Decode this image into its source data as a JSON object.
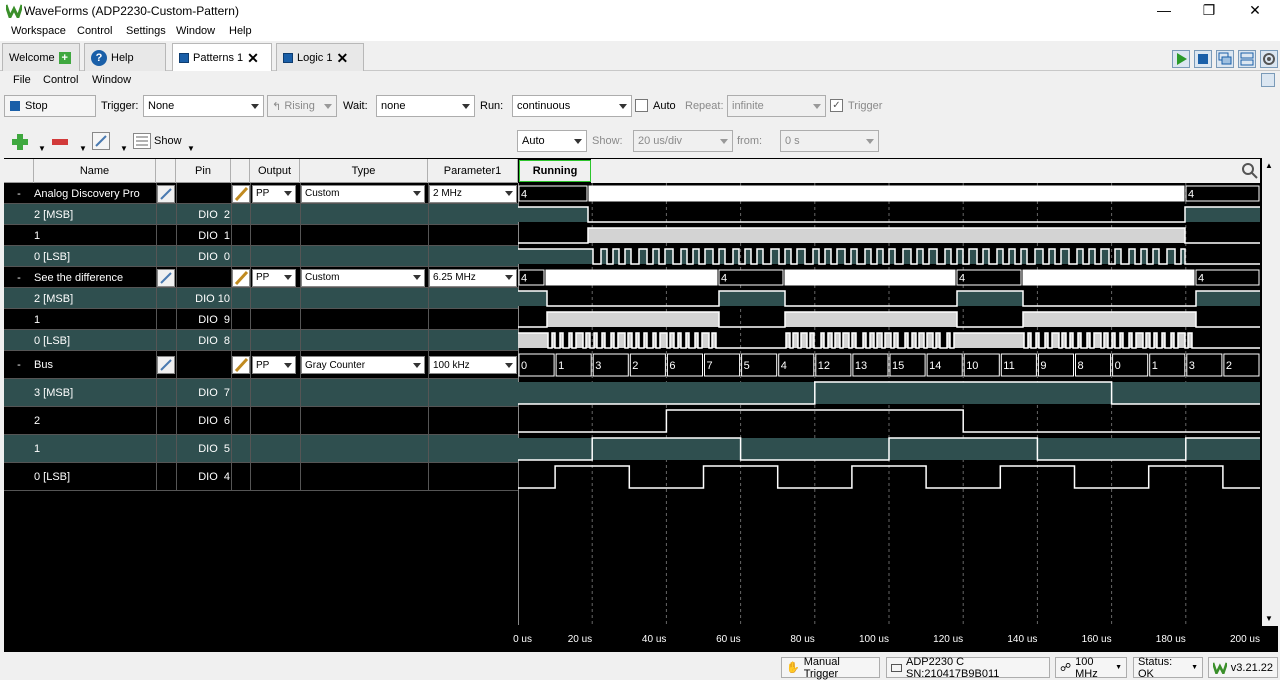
{
  "window": {
    "title": "WaveForms (ADP2230-Custom-Pattern)"
  },
  "menu": [
    "Workspace",
    "Control",
    "Settings",
    "Window",
    "Help"
  ],
  "tabs": [
    {
      "label": "Welcome"
    },
    {
      "label": "Help"
    },
    {
      "label": "Patterns 1",
      "active": true
    },
    {
      "label": "Logic 1"
    }
  ],
  "submenu": [
    "File",
    "Control",
    "Window"
  ],
  "toolbar": {
    "stop_label": "Stop",
    "trigger_label": "Trigger:",
    "trigger_value": "None",
    "edge_value": "Rising",
    "wait_label": "Wait:",
    "wait_value": "none",
    "run_label": "Run:",
    "run_value": "continuous",
    "auto_label": "Auto",
    "repeat_label": "Repeat:",
    "repeat_value": "infinite",
    "trigger_check_label": "Trigger"
  },
  "toolbar2": {
    "show_label": "Show",
    "mode_value": "Auto",
    "show2_label": "Show:",
    "div_value": "20 us/div",
    "from_label": "from:",
    "from_value": "0 s"
  },
  "columns": {
    "name": "Name",
    "pin": "Pin",
    "output": "Output",
    "type": "Type",
    "param": "Parameter1",
    "status": "Running"
  },
  "groups": [
    {
      "name": "Analog Discovery Pro",
      "output": "PP",
      "type": "Custom",
      "param": "2 MHz",
      "channels": [
        {
          "name": "2 [MSB]",
          "pin": "DIO  2"
        },
        {
          "name": "1",
          "pin": "DIO  1"
        },
        {
          "name": "0 [LSB]",
          "pin": "DIO  0"
        }
      ],
      "bus_values": [
        "4",
        "4"
      ]
    },
    {
      "name": "See the difference",
      "output": "PP",
      "type": "Custom",
      "param": "6.25 MHz",
      "channels": [
        {
          "name": "2 [MSB]",
          "pin": "DIO 10"
        },
        {
          "name": "1",
          "pin": "DIO  9"
        },
        {
          "name": "0 [LSB]",
          "pin": "DIO  8"
        }
      ],
      "bus_values": [
        "4",
        "4",
        "4",
        "4"
      ]
    },
    {
      "name": "Bus",
      "output": "PP",
      "type": "Gray Counter",
      "param": "100 kHz",
      "channels": [
        {
          "name": "3 [MSB]",
          "pin": "DIO  7"
        },
        {
          "name": "2",
          "pin": "DIO  6"
        },
        {
          "name": "1",
          "pin": "DIO  5"
        },
        {
          "name": "0 [LSB]",
          "pin": "DIO  4"
        }
      ],
      "bus_values": [
        "0",
        "1",
        "3",
        "2",
        "6",
        "7",
        "5",
        "4",
        "12",
        "13",
        "15",
        "14",
        "10",
        "11",
        "9",
        "8",
        "0",
        "1",
        "3",
        "2"
      ]
    }
  ],
  "time_ticks": [
    "0 us",
    "20 us",
    "40 us",
    "60 us",
    "80 us",
    "100 us",
    "120 us",
    "140 us",
    "160 us",
    "180 us",
    "200 us"
  ],
  "status": {
    "manual_trigger": "Manual Trigger",
    "device": "ADP2230 C SN:210417B9B011",
    "clock": "100 MHz",
    "status": "Status: OK",
    "version": "v3.21.22"
  },
  "colors": {
    "signal": "#2f4f4f",
    "high_fill": "#d3d3d3",
    "accent": "#1a5fa8",
    "running_border": "#2cc52c"
  }
}
